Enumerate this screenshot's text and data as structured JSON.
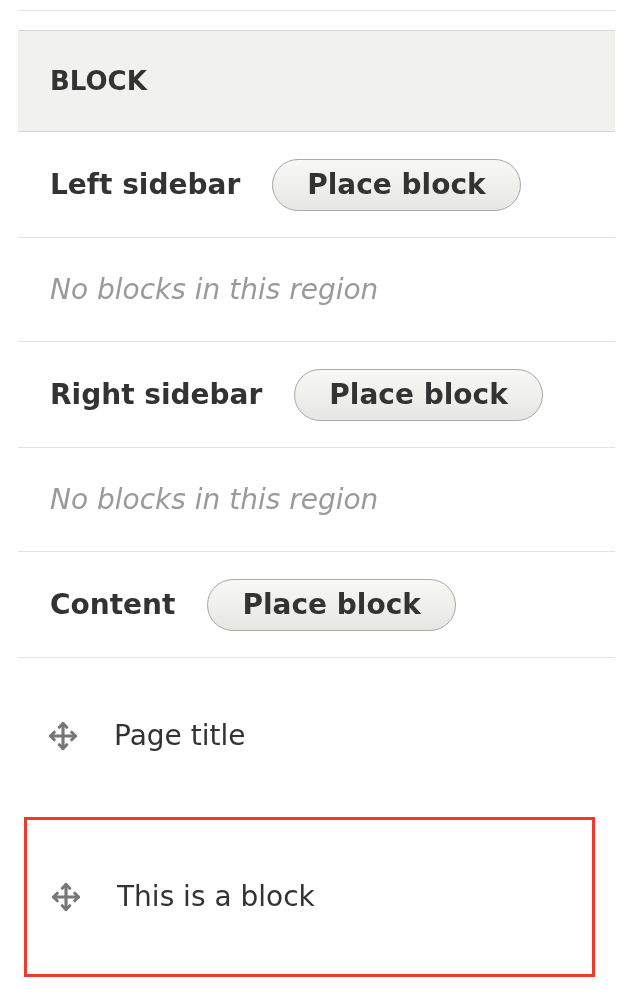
{
  "table": {
    "header": "BLOCK",
    "rows": [
      {
        "kind": "region",
        "label": "Left sidebar",
        "button": "Place block"
      },
      {
        "kind": "empty",
        "text": "No blocks in this region"
      },
      {
        "kind": "region",
        "label": "Right sidebar",
        "button": "Place block"
      },
      {
        "kind": "empty",
        "text": "No blocks in this region"
      },
      {
        "kind": "region",
        "label": "Content",
        "button": "Place block"
      },
      {
        "kind": "block",
        "label": "Page title",
        "highlighted": false
      },
      {
        "kind": "block",
        "label": "This is a block",
        "highlighted": true
      }
    ]
  }
}
